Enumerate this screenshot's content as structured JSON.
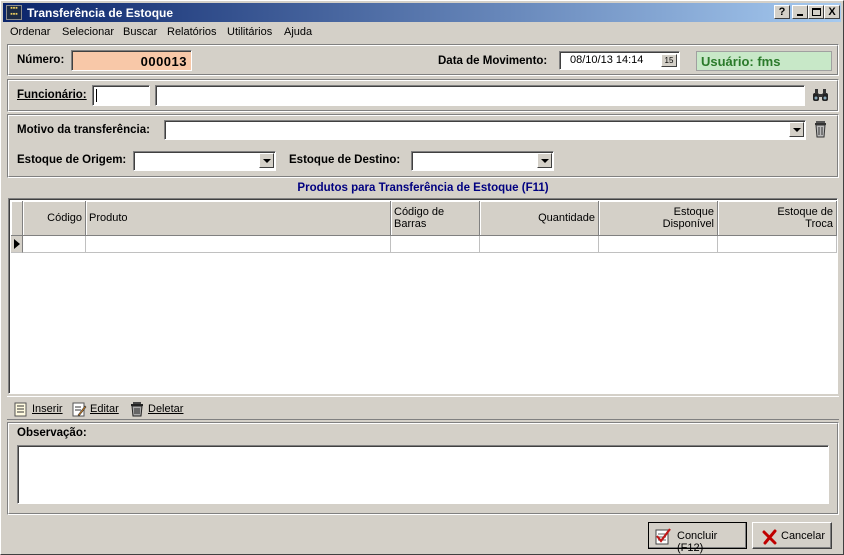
{
  "window": {
    "title": "Transferência de Estoque",
    "icon": "app-icon"
  },
  "title_buttons": {
    "help": "?",
    "minimize": "_",
    "maximize": "□",
    "close": "X"
  },
  "menu": [
    {
      "label": "Ordenar",
      "accel": "O"
    },
    {
      "label": "Selecionar",
      "accel": "S"
    },
    {
      "label": "Buscar",
      "accel": "B"
    },
    {
      "label": "Relatórios",
      "accel": "R"
    },
    {
      "label": "Utilitários",
      "accel": "U"
    },
    {
      "label": "Ajuda",
      "accel": "j"
    }
  ],
  "header": {
    "numero_label": "Número:",
    "numero_value": "000013",
    "data_label": "Data de Movimento:",
    "data_value": "08/10/13 14:14",
    "calendar_icon_text": "15",
    "usuario": "Usuário: fms"
  },
  "funcionario": {
    "label": "Funcionário:",
    "code": "",
    "name": "",
    "search_icon": "binoculars-icon"
  },
  "transfer": {
    "motivo_label": "Motivo da transferência:",
    "motivo_value": "",
    "origem_label": "Estoque de Origem:",
    "origem_value": "",
    "destino_label": "Estoque de Destino:",
    "destino_value": "",
    "trash_icon": "wastebasket-icon"
  },
  "products": {
    "title": "Produtos para Transferência de Estoque (F11)",
    "columns": [
      {
        "line1": "Código",
        "line2": ""
      },
      {
        "line1": "Produto",
        "line2": ""
      },
      {
        "line1": "Código de",
        "line2": "Barras"
      },
      {
        "line1": "Quantidade",
        "line2": ""
      },
      {
        "line1": "Estoque",
        "line2": "Disponível"
      },
      {
        "line1": "Estoque de",
        "line2": "Troca"
      }
    ]
  },
  "toolbar": {
    "inserir": "Inserir",
    "editar": "Editar",
    "deletar": "Deletar"
  },
  "observacao": {
    "label": "Observação:",
    "value": ""
  },
  "footer": {
    "concluir": "Concluir (F12)",
    "cancelar": "Cancelar"
  },
  "colors": {
    "usuario_bg": "#c8e8c8",
    "numero_bg": "#f8c8a8",
    "grid_title": "#000080"
  }
}
